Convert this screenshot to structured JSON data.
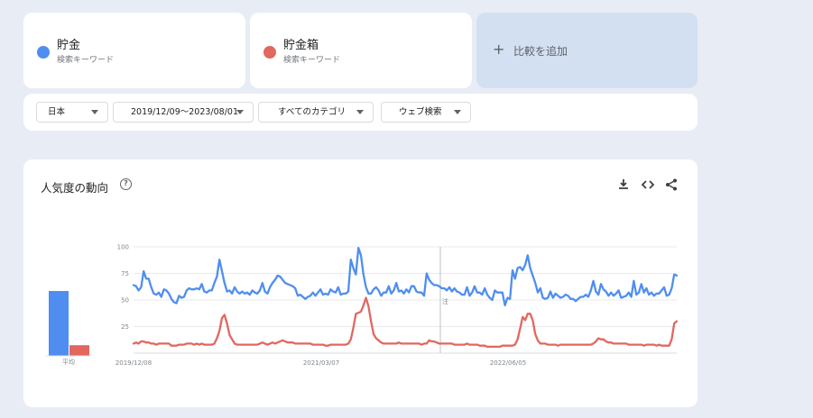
{
  "terms": [
    {
      "name": "貯金",
      "sub": "検索キーワード",
      "color": "#4f8ef0"
    },
    {
      "name": "貯金箱",
      "sub": "検索キーワード",
      "color": "#e2675f"
    }
  ],
  "add_compare": {
    "plus": "+",
    "label": "比較を追加"
  },
  "filters": [
    {
      "label": "日本"
    },
    {
      "label": "2019/12/09〜2023/08/01"
    },
    {
      "label": "すべてのカテゴリ"
    },
    {
      "label": "ウェブ検索"
    }
  ],
  "trend": {
    "title": "人気度の動向",
    "help": "?",
    "avg_label": "平均",
    "note_label": "注"
  },
  "chart_data": {
    "type": "line",
    "x_ticks": [
      "2019/12/08",
      "2021/03/07",
      "2022/06/05"
    ],
    "y_ticks": [
      100,
      75,
      50,
      25
    ],
    "ylim": [
      0,
      100
    ],
    "grid": true,
    "averages": [
      {
        "name": "貯金",
        "value": 61,
        "color": "#4f8ef0"
      },
      {
        "name": "貯金箱",
        "value": 10,
        "color": "#e2675f"
      }
    ],
    "series": [
      {
        "name": "貯金",
        "color": "#4f8ef0",
        "values": [
          64,
          63,
          59,
          62,
          77,
          70,
          70,
          62,
          56,
          55,
          57,
          53,
          60,
          59,
          56,
          51,
          48,
          47,
          54,
          52,
          53,
          59,
          61,
          60,
          60,
          61,
          60,
          65,
          58,
          57,
          59,
          59,
          66,
          72,
          88,
          77,
          66,
          58,
          59,
          56,
          62,
          58,
          56,
          58,
          56,
          57,
          55,
          59,
          57,
          56,
          59,
          66,
          58,
          56,
          62,
          66,
          69,
          73,
          72,
          69,
          66,
          65,
          64,
          63,
          61,
          54,
          55,
          53,
          51,
          53,
          54,
          57,
          54,
          57,
          60,
          55,
          56,
          55,
          60,
          58,
          57,
          62,
          55,
          56,
          56,
          58,
          88,
          80,
          74,
          99,
          92,
          74,
          62,
          56,
          56,
          60,
          62,
          59,
          54,
          57,
          57,
          63,
          56,
          59,
          66,
          58,
          59,
          56,
          60,
          57,
          63,
          63,
          58,
          57,
          57,
          54,
          75,
          69,
          66,
          64,
          64,
          63,
          61,
          61,
          59,
          62,
          58,
          61,
          58,
          57,
          55,
          55,
          62,
          54,
          57,
          63,
          57,
          57,
          55,
          61,
          55,
          52,
          50,
          59,
          57,
          57,
          57,
          45,
          52,
          51,
          78,
          70,
          80,
          81,
          78,
          83,
          92,
          80,
          73,
          66,
          57,
          61,
          52,
          51,
          52,
          58,
          52,
          56,
          54,
          52,
          53,
          55,
          54,
          51,
          51,
          49,
          51,
          53,
          53,
          55,
          53,
          59,
          68,
          58,
          55,
          65,
          60,
          58,
          54,
          57,
          54,
          56,
          59,
          52,
          53,
          54,
          57,
          53,
          68,
          55,
          57,
          65,
          57,
          61,
          55,
          57,
          54,
          56,
          56,
          59,
          62,
          54,
          55,
          61,
          74,
          73
        ]
      },
      {
        "name": "貯金箱",
        "color": "#e2675f",
        "values": [
          9,
          10,
          9,
          11,
          11,
          10,
          10,
          9,
          9,
          8,
          9,
          9,
          9,
          9,
          9,
          7,
          7,
          7,
          8,
          8,
          8,
          9,
          9,
          9,
          8,
          9,
          8,
          9,
          8,
          8,
          8,
          8,
          9,
          14,
          21,
          33,
          36,
          28,
          17,
          13,
          9,
          8,
          8,
          8,
          8,
          8,
          8,
          8,
          8,
          8,
          9,
          10,
          9,
          8,
          9,
          10,
          9,
          10,
          11,
          12,
          11,
          10,
          10,
          10,
          9,
          9,
          9,
          9,
          9,
          9,
          9,
          8,
          8,
          8,
          8,
          8,
          7,
          7,
          8,
          8,
          8,
          8,
          8,
          8,
          8,
          9,
          13,
          24,
          37,
          38,
          39,
          45,
          52,
          44,
          30,
          18,
          14,
          12,
          10,
          9,
          9,
          9,
          9,
          9,
          9,
          10,
          9,
          9,
          9,
          9,
          9,
          9,
          9,
          9,
          8,
          9,
          9,
          12,
          11,
          11,
          10,
          9,
          9,
          9,
          9,
          9,
          9,
          8,
          8,
          8,
          8,
          8,
          9,
          8,
          8,
          8,
          8,
          7,
          7,
          7,
          6,
          6,
          6,
          6,
          6,
          6,
          7,
          7,
          7,
          7,
          7,
          8,
          13,
          23,
          34,
          31,
          37,
          37,
          31,
          18,
          12,
          9,
          9,
          9,
          8,
          8,
          8,
          8,
          7,
          8,
          8,
          8,
          8,
          8,
          8,
          8,
          8,
          8,
          8,
          8,
          8,
          8,
          9,
          11,
          14,
          13,
          13,
          11,
          10,
          10,
          9,
          9,
          9,
          9,
          9,
          9,
          8,
          8,
          8,
          8,
          8,
          8,
          7,
          8,
          8,
          8,
          8,
          7,
          8,
          7,
          7,
          7,
          7,
          13,
          28,
          30
        ]
      }
    ]
  }
}
